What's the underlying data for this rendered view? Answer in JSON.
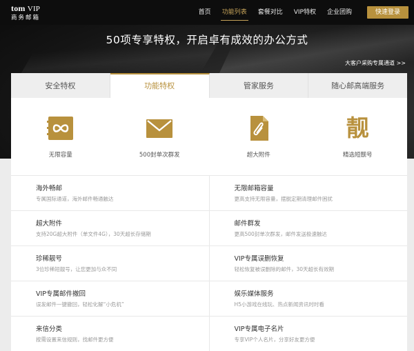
{
  "brand": {
    "line1_a": "tom",
    "line1_b": "VIP",
    "line2": "商务邮箱"
  },
  "nav": {
    "items": [
      "首页",
      "功能列表",
      "套餐对比",
      "VIP特权",
      "企业团购"
    ],
    "active_index": 1,
    "login_label": "快速登录"
  },
  "hero": {
    "title": "50项专享特权，开启卓有成效的办公方式",
    "enterprise_link": "大客户采购专属通道 >>"
  },
  "tabs": [
    "安全特权",
    "功能特权",
    "管家服务",
    "随心邮高端服务"
  ],
  "active_tab": 1,
  "features": [
    {
      "icon": "infinity-icon",
      "label": "无限容量"
    },
    {
      "icon": "envelope-icon",
      "label": "500封单次群发"
    },
    {
      "icon": "paperclip-file-icon",
      "label": "超大附件"
    },
    {
      "icon": "liang-character-icon",
      "label": "精选短靓号",
      "glyph": "靓"
    }
  ],
  "rows": [
    [
      {
        "title": "海外畅邮",
        "desc": "专属国际通道，海外邮件畅通触达"
      },
      {
        "title": "无限邮箱容量",
        "desc": "更高支持无限容量，摆脱定期清理邮件困扰"
      }
    ],
    [
      {
        "title": "超大附件",
        "desc": "支持20G超大附件（单文件4G），30天超长存储期"
      },
      {
        "title": "邮件群发",
        "desc": "更高500封单次群发，邮件发送极速触达"
      }
    ],
    [
      {
        "title": "珍稀靓号",
        "desc": "3位珍稀短靓号，让您更加与众不同"
      },
      {
        "title": "VIP专属误删恢复",
        "desc": "轻松恢复被误删除的邮件，30天超长有效期"
      }
    ],
    [
      {
        "title": "VIP专属邮件撤回",
        "desc": "误发邮件一键撤回，轻松化解“小危机”"
      },
      {
        "title": "娱乐媒体服务",
        "desc": "H5小游戏在线玩、热点新闻资讯时时看"
      }
    ],
    [
      {
        "title": "来信分类",
        "desc": "按需设置来信规则，找邮件更方便"
      },
      {
        "title": "VIP专属电子名片",
        "desc": "专享VIP个人名片，分享好友更方便"
      }
    ]
  ],
  "colors": {
    "gold": "#b8913d",
    "accent_text": "#c7a45a",
    "topbar": "#0d0d0d"
  }
}
